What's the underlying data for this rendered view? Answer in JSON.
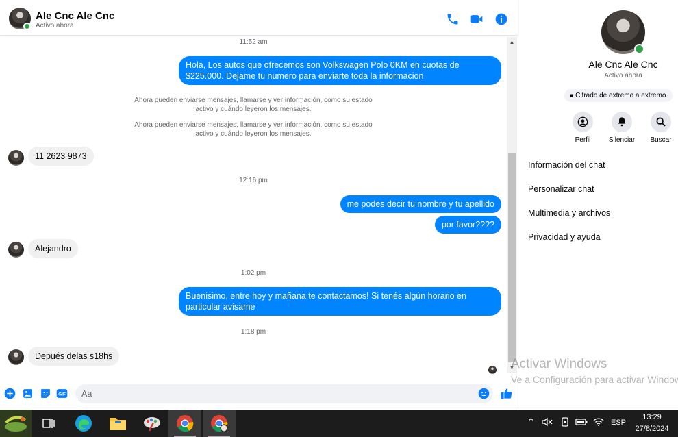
{
  "header": {
    "name": "Ale Cnc Ale Cnc",
    "status": "Activo ahora",
    "icons": [
      "phone-icon",
      "video-camera-icon",
      "info-icon"
    ]
  },
  "messages": {
    "ts1": "11:52 am",
    "out1": "Hola, Los autos que ofrecemos son Volkswagen Polo 0KM en cuotas de $225.000. Dejame tu numero para enviarte toda la informacion",
    "sys1": "Ahora pueden enviarse mensajes, llamarse y ver información, como su estado activo y cuándo leyeron los mensajes.",
    "sys2": "Ahora pueden enviarse mensajes, llamarse y ver información, como su estado activo y cuándo leyeron los mensajes.",
    "in1": "11 2623 9873",
    "ts2": "12:16 pm",
    "out2": "me podes decir tu nombre y tu apellido",
    "out3": "por favor????",
    "in2": "Alejandro",
    "ts3": "1:02 pm",
    "out4": "Buenisimo, entre hoy y mañana te contactamos! Si tenés algún horario en particular avisame",
    "ts4": "1:18 pm",
    "in3": "Depués delas s18hs"
  },
  "composer": {
    "placeholder": "Aa",
    "icons": [
      "plus-icon",
      "image-icon",
      "sticker-icon",
      "gif-icon",
      "emoji-icon",
      "like-icon"
    ],
    "gif_label": "GIF"
  },
  "details": {
    "name": "Ale Cnc Ale Cnc",
    "status": "Activo ahora",
    "encryption": "Cifrado de extremo a extremo",
    "actions": [
      {
        "label": "Perfil",
        "icon": "profile-icon"
      },
      {
        "label": "Silenciar",
        "icon": "bell-icon"
      },
      {
        "label": "Buscar",
        "icon": "search-icon"
      }
    ],
    "menu": [
      "Información del chat",
      "Personalizar chat",
      "Multimedia y archivos",
      "Privacidad y ayuda"
    ],
    "watermark_title": "Activar Windows",
    "watermark_sub": "Ve a Configuración para activar Windows."
  },
  "taskbar": {
    "apps": [
      "start",
      "task-view",
      "edge",
      "file-explorer",
      "paint",
      "chrome",
      "chrome"
    ],
    "language": "ESP",
    "time": "13:29",
    "date": "27/8/2024"
  },
  "colors": {
    "accent": "#0084ff",
    "icon_blue": "#0a7cff",
    "incoming_bubble": "#f0f0f0",
    "online": "#31a24c",
    "taskbar": "#1c1c1c"
  }
}
